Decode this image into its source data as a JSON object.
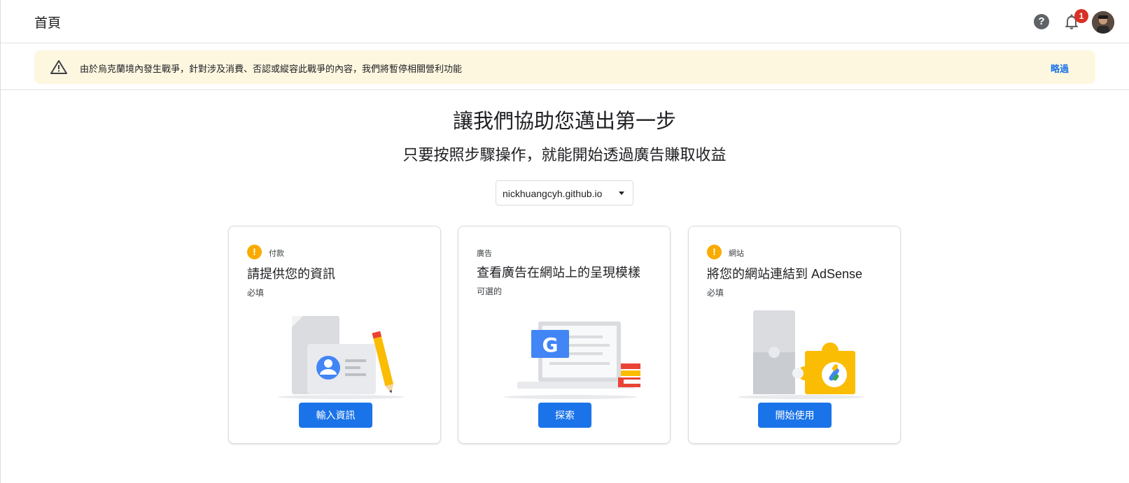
{
  "header": {
    "title": "首頁",
    "help_icon": "help-circle-icon",
    "notifications_count": "1"
  },
  "banner": {
    "message": "由於烏克蘭境內發生戰爭，針對涉及消費、否認或縱容此戰爭的內容，我們將暫停相關營利功能",
    "dismiss_label": "略過"
  },
  "main": {
    "headline": "讓我們協助您邁出第一步",
    "subheadline": "只要按照步驟操作，就能開始透過廣告賺取收益",
    "site_selector": {
      "value": "nickhuangcyh.github.io"
    }
  },
  "cards": [
    {
      "category": "付款",
      "title": "請提供您的資訊",
      "requirement": "必填",
      "button_label": "輸入資訊",
      "alert_icon": "exclamation-icon"
    },
    {
      "category": "廣告",
      "title": "查看廣告在網站上的呈現模樣",
      "requirement": "可選的",
      "button_label": "探索"
    },
    {
      "category": "網站",
      "title": "將您的網站連結到 AdSense",
      "requirement": "必填",
      "button_label": "開始使用",
      "alert_icon": "exclamation-icon"
    }
  ],
  "colors": {
    "primary": "#1a73e8",
    "warning": "#f9ab00",
    "banner_bg": "#fef7e0",
    "badge": "#d93025"
  }
}
